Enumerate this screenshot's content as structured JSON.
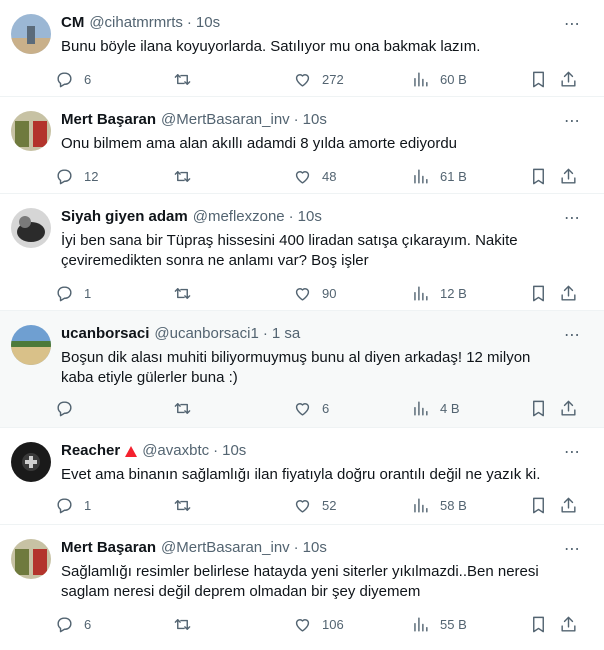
{
  "tweets": [
    {
      "name": "CM",
      "handle": "@cihatmrmrts",
      "sep": "·",
      "time": "10s",
      "badge": false,
      "text": "Bunu böyle ilana koyuyorlarda. Satılıyor mu ona bakmak lazım.",
      "replies": "6",
      "retweets": "",
      "likes": "272",
      "views": "60 B",
      "avatar_colors": [
        "#9bb7d4",
        "#c9b08a",
        "#5b6b7a"
      ]
    },
    {
      "name": "Mert Başaran",
      "handle": "@MertBasaran_inv",
      "sep": "·",
      "time": "10s",
      "badge": false,
      "text": "Onu bilmem ama alan akıllı adamdi 8 yılda amorte ediyordu",
      "replies": "12",
      "retweets": "",
      "likes": "48",
      "views": "61 B",
      "avatar_colors": [
        "#c7c2a4",
        "#6f7a3e",
        "#b3342c"
      ]
    },
    {
      "name": "Siyah giyen adam",
      "handle": "@meflexzone",
      "sep": "·",
      "time": "10s",
      "badge": false,
      "text_lines": [
        "İyi ben sana bir Tüpraş hissesini 400 liradan satışa çıkarayım. Nakite",
        "çeviremedikten sonra ne anlamı var? Boş işler"
      ],
      "replies": "1",
      "retweets": "",
      "likes": "90",
      "views": "12 B",
      "avatar_colors": [
        "#d6d6d6",
        "#2b2b2b",
        "#7a7a7a"
      ]
    },
    {
      "name": "ucanborsaci",
      "handle": "@ucanborsaci1",
      "sep": "·",
      "time": "1 sa",
      "badge": false,
      "text_lines": [
        "Boşun dik alası muhiti biliyormuymuş bunu al diyen arkadaş! 12 milyon",
        "kaba etiyle gülerler buna :)"
      ],
      "replies": "",
      "retweets": "",
      "likes": "6",
      "views": "4 B",
      "avatar_colors": [
        "#6f9fd1",
        "#d9c189",
        "#4d7a3a"
      ]
    },
    {
      "name": "Reacher",
      "handle": "@avaxbtc",
      "sep": "·",
      "time": "10s",
      "badge": true,
      "text": "Evet ama binanın sağlamlığı ilan fiyatıyla doğru orantılı değil ne yazık ki.",
      "replies": "1",
      "retweets": "",
      "likes": "52",
      "views": "58 B",
      "avatar_colors": [
        "#1a1a1a",
        "#3a3a3a",
        "#cfcfcf"
      ]
    },
    {
      "name": "Mert Başaran",
      "handle": "@MertBasaran_inv",
      "sep": "·",
      "time": "10s",
      "badge": false,
      "text_lines": [
        "Sağlamlığı resimler belirlese hatayda yeni siterler yıkılmazdi..Ben neresi",
        "saglam neresi değil deprem olmadan bir şey diyemem"
      ],
      "replies": "6",
      "retweets": "",
      "likes": "106",
      "views": "55 B",
      "avatar_colors": [
        "#c7c2a4",
        "#6f7a3e",
        "#b3342c"
      ]
    }
  ]
}
